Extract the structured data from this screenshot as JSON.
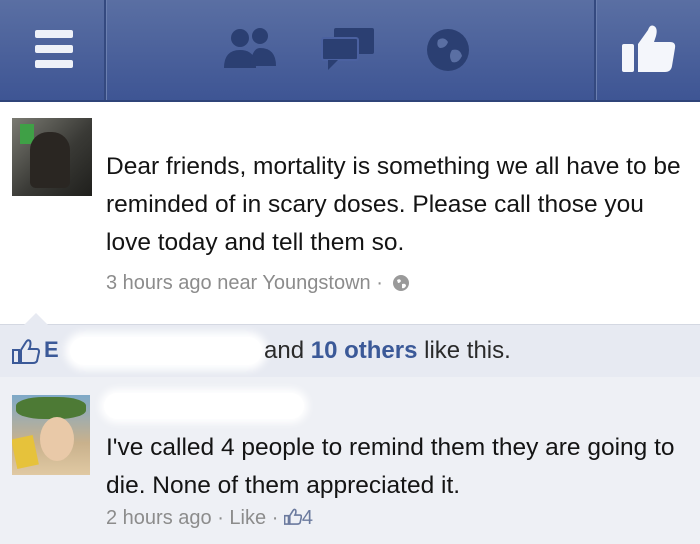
{
  "post": {
    "text": "Dear friends, mortality is something we all have to be reminded of in scary doses. Please call those you love today and tell them so.",
    "meta": "3 hours ago near Youngstown ·"
  },
  "likes": {
    "initial": "E",
    "text_prefix": "and ",
    "others": "10 others",
    "text_suffix": " like this."
  },
  "comment": {
    "text": "I've called 4 people to remind them they are going to die. None of them appreciated it.",
    "time": "2 hours ago ·",
    "like_label": "Like",
    "sep": "·",
    "like_count": "4"
  },
  "colors": {
    "topbar": "#3e5594",
    "link": "#3b5998",
    "meta": "#8c8c8c"
  }
}
